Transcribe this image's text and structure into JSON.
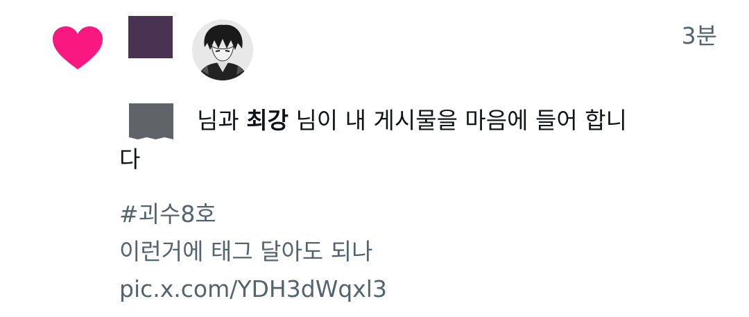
{
  "notification": {
    "time": "3분",
    "text_part1": "님과 ",
    "bold_name": "최강",
    "text_part2": " 님이 내 게시물을 마음에 들어 합니다"
  },
  "post": {
    "hashtag": "#괴수8호",
    "text": "이런거에 태그 달아도 되나",
    "link": "pic.x.com/YDH3dWqxl3"
  },
  "colors": {
    "heart": "#f91880",
    "text_primary": "#0f1419",
    "text_secondary": "#536471"
  }
}
